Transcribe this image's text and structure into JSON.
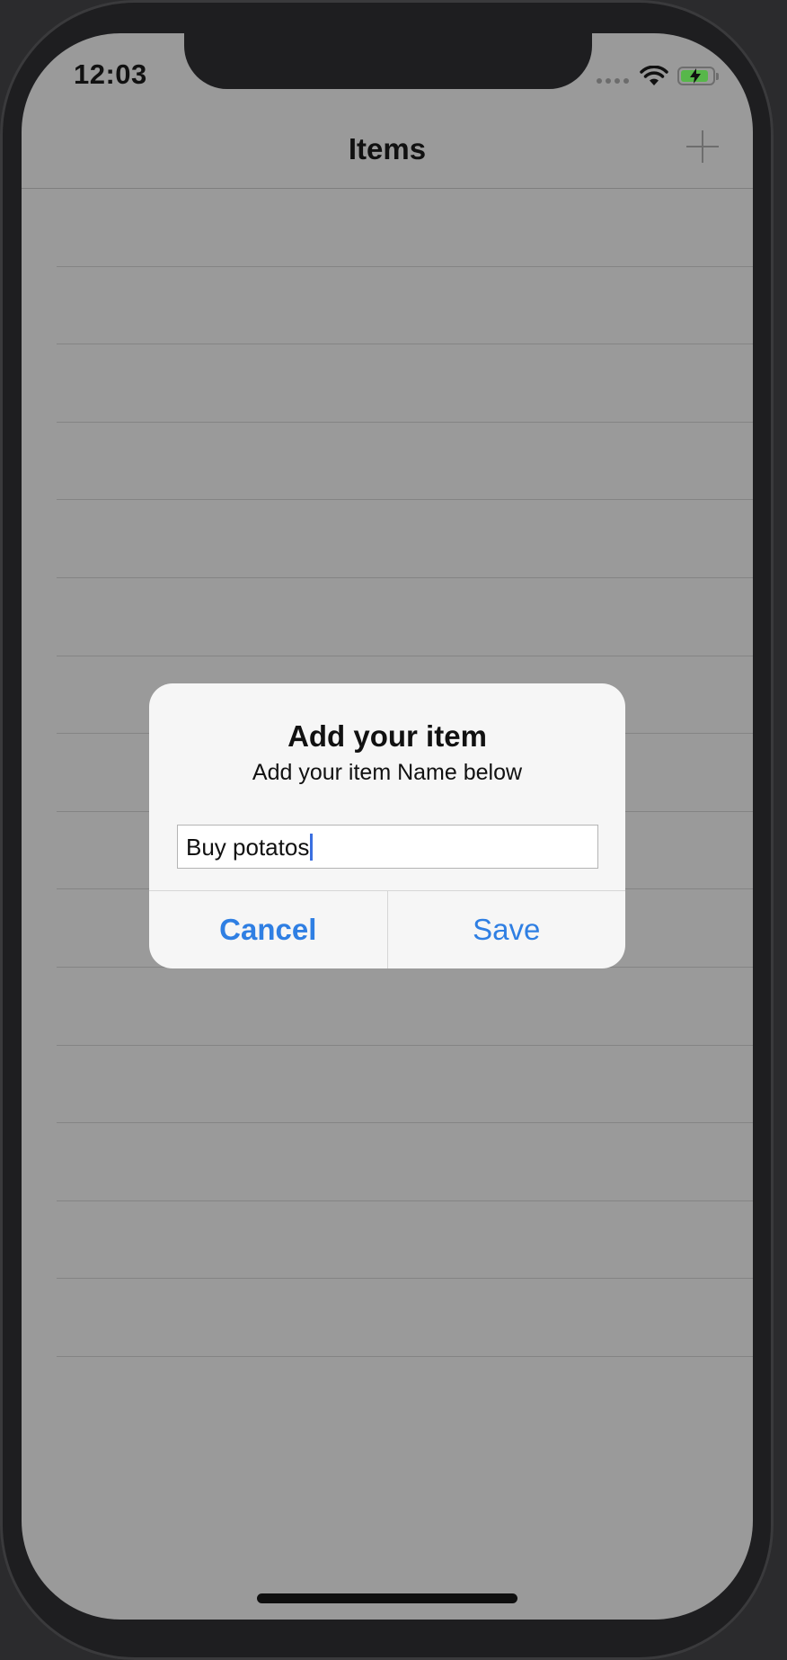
{
  "status_bar": {
    "time": "12:03",
    "icons": [
      "cellular-signal-icon",
      "wifi-icon",
      "battery-charging-icon"
    ],
    "battery_color": "#57b74a"
  },
  "nav_bar": {
    "title": "Items",
    "right_button_icon": "plus-icon"
  },
  "table": {
    "row_count": 15
  },
  "alert": {
    "title": "Add your item",
    "message": "Add your item Name below",
    "input_value": "Buy potatos",
    "cancel_label": "Cancel",
    "save_label": "Save",
    "accent_color": "#2f7fe3"
  },
  "colors": {
    "dimmed_background": "#9a9a9a",
    "device_frame": "#1e1e20"
  }
}
